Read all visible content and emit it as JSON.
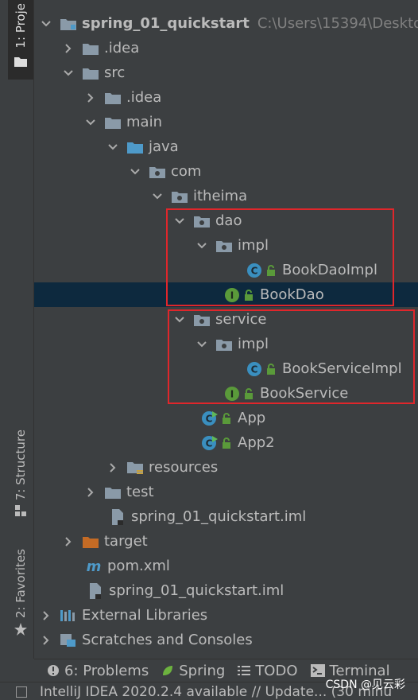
{
  "sidebar": {
    "project_tab": "1: Proje",
    "structure_tab": "7: Structure",
    "favorites_tab": "2: Favorites"
  },
  "tree": {
    "root": {
      "label": "spring_01_quickstart",
      "path": "C:\\Users\\15394\\Deskto"
    },
    "rows": [
      {
        "label": ".idea"
      },
      {
        "label": "src"
      },
      {
        "label": ".idea"
      },
      {
        "label": "main"
      },
      {
        "label": "java"
      },
      {
        "label": "com"
      },
      {
        "label": "itheima"
      },
      {
        "label": "dao"
      },
      {
        "label": "impl"
      },
      {
        "label": "BookDaoImpl"
      },
      {
        "label": "BookDao"
      },
      {
        "label": "service"
      },
      {
        "label": "impl"
      },
      {
        "label": "BookServiceImpl"
      },
      {
        "label": "BookService"
      },
      {
        "label": "App"
      },
      {
        "label": "App2"
      },
      {
        "label": "resources"
      },
      {
        "label": "test"
      },
      {
        "label": "spring_01_quickstart.iml"
      },
      {
        "label": "target"
      },
      {
        "label": "pom.xml"
      },
      {
        "label": "spring_01_quickstart.iml"
      },
      {
        "label": "External Libraries"
      },
      {
        "label": "Scratches and Consoles"
      }
    ]
  },
  "bottom_tabs": {
    "problems": "6: Problems",
    "spring": "Spring",
    "todo": "TODO",
    "terminal": "Terminal"
  },
  "status": {
    "message": "IntelliJ IDEA 2020.2.4 available // Update... (30 minu"
  },
  "watermark": "CSDN @见云彩",
  "colors": {
    "background": "#3c3f41",
    "selection": "#0d293e",
    "annotation_box": "#e0262b",
    "folder": "#8a9aa8",
    "source_folder": "#4e9ac9",
    "target_folder": "#c46b25",
    "class_icon": "#3a8fbf",
    "interface_icon": "#5a9a3a"
  }
}
